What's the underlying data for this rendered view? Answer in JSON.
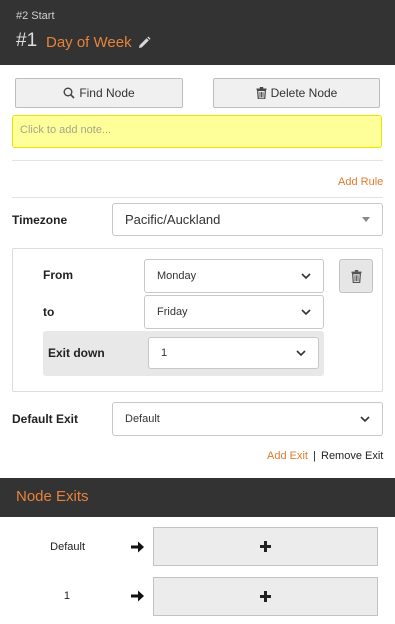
{
  "header": {
    "subtitle": "#2 Start",
    "number": "#1",
    "title": "Day of Week"
  },
  "actions": {
    "find_node": "Find Node",
    "delete_node": "Delete Node"
  },
  "note": {
    "placeholder": "Click to add note..."
  },
  "rules": {
    "add_rule": "Add Rule",
    "timezone_label": "Timezone",
    "timezone_value": "Pacific/Auckland",
    "from_label": "From",
    "from_value": "Monday",
    "to_label": "to",
    "to_value": "Friday",
    "exit_down_label": "Exit down",
    "exit_down_value": "1"
  },
  "default_exit": {
    "label": "Default Exit",
    "value": "Default",
    "add_exit": "Add Exit",
    "separator": "|",
    "remove_exit": "Remove Exit"
  },
  "node_exits": {
    "title": "Node Exits",
    "items": [
      {
        "label": "Default"
      },
      {
        "label": "1"
      }
    ]
  },
  "colors": {
    "header_bg": "#333333",
    "accent": "#e8823a",
    "note_bg": "#ffff99"
  }
}
